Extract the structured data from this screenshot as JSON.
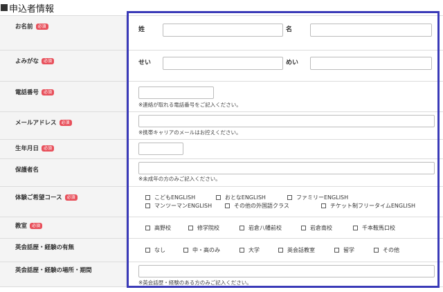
{
  "section": {
    "title": "申込者情報"
  },
  "required_label": "必須",
  "rows": {
    "name": {
      "label": "お名前",
      "sei_label": "姓",
      "mei_label": "名",
      "sei_value": "",
      "mei_value": ""
    },
    "kana": {
      "label": "よみがな",
      "sei_label": "せい",
      "mei_label": "めい",
      "sei_value": "",
      "mei_value": ""
    },
    "phone": {
      "label": "電話番号",
      "value": "",
      "note": "※連絡が取れる電話番号をご記入ください。"
    },
    "email": {
      "label": "メールアドレス",
      "value": "",
      "note": "※携帯キャリアのメールはお控えください。"
    },
    "birthday": {
      "label": "生年月日",
      "value": ""
    },
    "guardian": {
      "label": "保護者名",
      "value": "",
      "note": "※未成年の方のみご記入ください。"
    },
    "course": {
      "label": "体験ご希望コース",
      "options": [
        "こどもENGLISH",
        "おとなENGLISH",
        "ファミリーENGLISH",
        "マンツーマンENGLISH",
        "その他の外国語クラス",
        "チケット制フリータイムENGLISH"
      ]
    },
    "school": {
      "label": "教室",
      "options": [
        "高野校",
        "修学院校",
        "岩倉八幡前校",
        "岩倉南校",
        "千本鞍馬口校"
      ]
    },
    "experience": {
      "label": "英会話歴・経験の有無",
      "options": [
        "なし",
        "中・高のみ",
        "大学",
        "英会話教室",
        "留学",
        "その他"
      ]
    },
    "experience_detail": {
      "label": "英会話歴・経験の場所・期間",
      "value": "",
      "note": "※英会話歴・経験のある方のみご記入ください。"
    }
  },
  "colors": {
    "frame": "#3a3ab8",
    "required_badge": "#e8505b",
    "label_bg": "#f4f4f4"
  }
}
